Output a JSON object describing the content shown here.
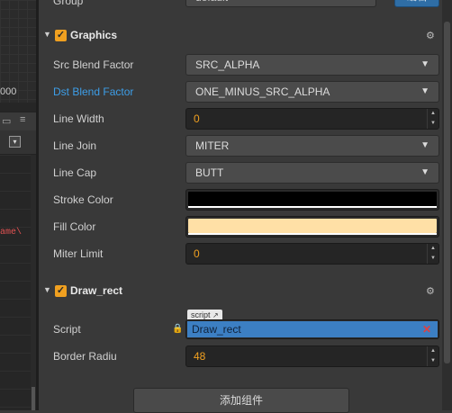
{
  "left_panel": {
    "axis_number": "000",
    "hamburger_icon": "≡",
    "code_fragment": "ame\\"
  },
  "group_row": {
    "label": "Group",
    "value": "default",
    "edit_button": "编辑"
  },
  "graphics": {
    "title": "Graphics",
    "enabled": true,
    "fields": {
      "src_blend_factor": {
        "label": "Src Blend Factor",
        "value": "SRC_ALPHA"
      },
      "dst_blend_factor": {
        "label": "Dst Blend Factor",
        "value": "ONE_MINUS_SRC_ALPHA"
      },
      "line_width": {
        "label": "Line Width",
        "value": "0"
      },
      "line_join": {
        "label": "Line Join",
        "value": "MITER"
      },
      "line_cap": {
        "label": "Line Cap",
        "value": "BUTT"
      },
      "stroke_color": {
        "label": "Stroke Color",
        "color": "#000000"
      },
      "fill_color": {
        "label": "Fill Color",
        "color": "#ffe0a6"
      },
      "miter_limit": {
        "label": "Miter Limit",
        "value": "0"
      }
    }
  },
  "draw_rect": {
    "title": "Draw_rect",
    "enabled": true,
    "script_label": "Script",
    "script_tag": "script",
    "script_value": "Draw_rect",
    "border_radius_label": "Border Radiu",
    "border_radius_value": "48"
  },
  "add_component_button": "添加组件",
  "colors": {
    "accent_orange": "#f0a020",
    "link_blue": "#3d9ee8",
    "script_blue": "#3c7fc3"
  }
}
